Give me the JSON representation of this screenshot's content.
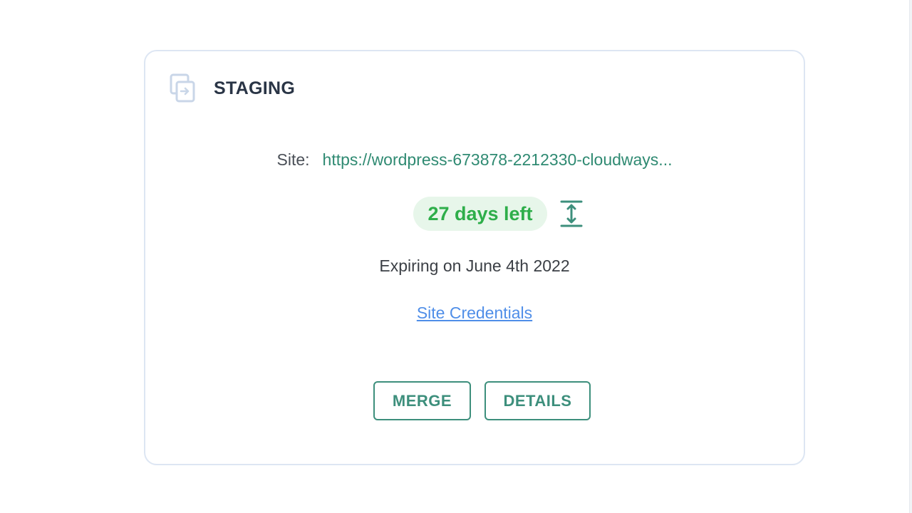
{
  "card": {
    "title": "STAGING",
    "icon": "staging-copy-icon"
  },
  "site": {
    "label": "Site:",
    "url": "https://wordpress-673878-2212330-cloudways..."
  },
  "status": {
    "days_left": "27 days left",
    "extend_icon": "extend-expiry-icon"
  },
  "expiry": {
    "text": "Expiring on June 4th 2022"
  },
  "credentials": {
    "link_label": "Site Credentials"
  },
  "actions": {
    "merge_label": "MERGE",
    "details_label": "DETAILS"
  },
  "colors": {
    "accent": "#3d8f7c",
    "badge_text": "#2eae4a",
    "badge_bg": "#e7f6ea",
    "link": "#4f8ee8",
    "card_border": "#dde6f3"
  }
}
